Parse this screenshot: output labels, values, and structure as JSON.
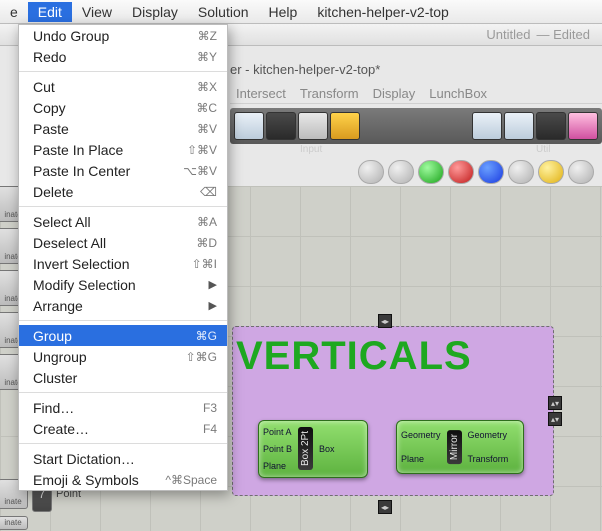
{
  "menubar": {
    "items": [
      "e",
      "Edit",
      "View",
      "Display",
      "Solution",
      "Help",
      "kitchen-helper-v2-top"
    ],
    "active_index": 1
  },
  "titlebar": {
    "doc": "Untitled",
    "status": "Edited"
  },
  "inner_title": "er - kitchen-helper-v2-top*",
  "tabs": [
    "Intersect",
    "Transform",
    "Display",
    "LunchBox"
  ],
  "strip_labels": {
    "input": "Input",
    "util": "Util"
  },
  "dropdown": {
    "undo_group": "Undo Group",
    "undo_group_sc": "⌘Z",
    "redo": "Redo",
    "redo_sc": "⌘Y",
    "cut": "Cut",
    "cut_sc": "⌘X",
    "copy": "Copy",
    "copy_sc": "⌘C",
    "paste": "Paste",
    "paste_sc": "⌘V",
    "paste_in_place": "Paste In Place",
    "paste_in_place_sc": "⇧⌘V",
    "paste_in_center": "Paste In Center",
    "paste_in_center_sc": "⌥⌘V",
    "delete": "Delete",
    "delete_sc": "⌫",
    "select_all": "Select All",
    "select_all_sc": "⌘A",
    "deselect_all": "Deselect All",
    "deselect_all_sc": "⌘D",
    "invert_selection": "Invert Selection",
    "invert_selection_sc": "⇧⌘I",
    "modify_selection": "Modify Selection",
    "arrange": "Arrange",
    "group": "Group",
    "group_sc": "⌘G",
    "ungroup": "Ungroup",
    "ungroup_sc": "⇧⌘G",
    "cluster": "Cluster",
    "find": "Find…",
    "find_sc": "F3",
    "create": "Create…",
    "create_sc": "F4",
    "start_dictation": "Start Dictation…",
    "emoji": "Emoji & Symbols",
    "emoji_sc": "^⌘Space"
  },
  "canvas": {
    "group_label": "VERTICALS",
    "box2pt": {
      "name": "Box 2Pt",
      "in": [
        "Point A",
        "Point B",
        "Plane"
      ],
      "out": [
        "Box"
      ]
    },
    "mirror": {
      "name": "Mirror",
      "in": [
        "Geometry",
        "Plane"
      ],
      "out": [
        "Geometry",
        "Transform"
      ]
    },
    "left_items": [
      "inate",
      "inate",
      "inate",
      "inate",
      "inate",
      "inate",
      "inate"
    ],
    "slider_value": "7",
    "slider_label": "Point"
  }
}
